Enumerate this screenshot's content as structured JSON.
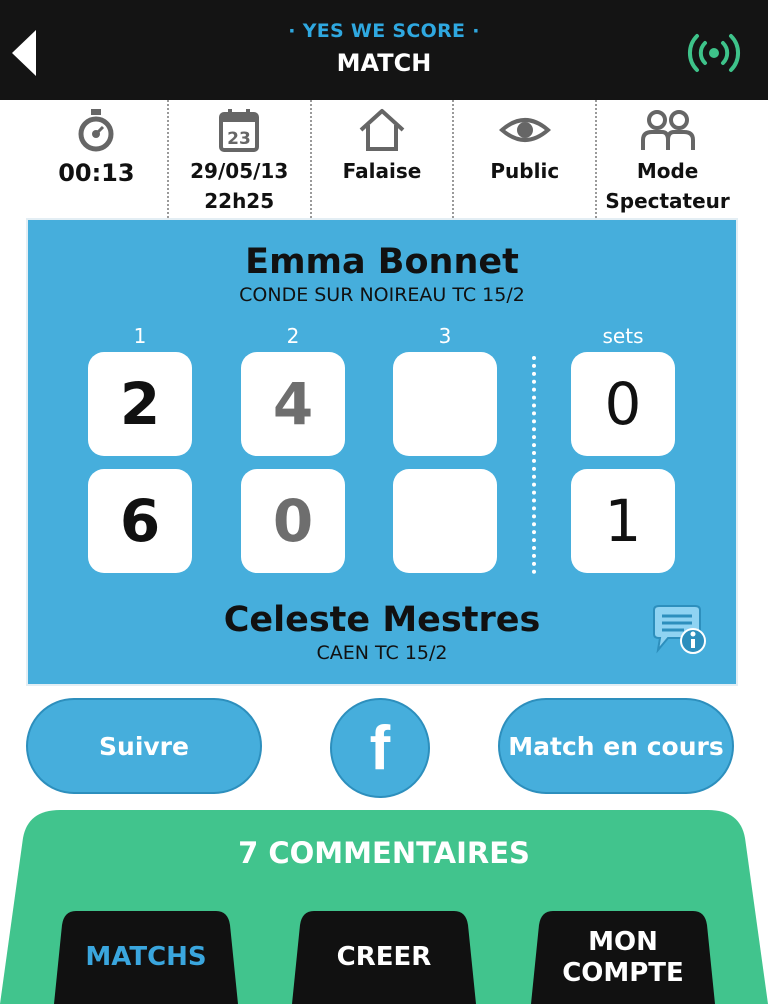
{
  "header": {
    "brand": "· YES WE SCORE ·",
    "title": "MATCH"
  },
  "info": {
    "timer": "00:13",
    "date": "29/05/13",
    "time": "22h25",
    "calendar_day": "23",
    "location": "Falaise",
    "visibility": "Public",
    "mode_line1": "Mode",
    "mode_line2": "Spectateur"
  },
  "match": {
    "player1": {
      "name": "Emma Bonnet",
      "club": "CONDE SUR NOIREAU TC 15/2"
    },
    "player2": {
      "name": "Celeste Mestres",
      "club": "CAEN TC 15/2"
    },
    "column_labels": [
      "1",
      "2",
      "3",
      "sets"
    ],
    "player1_scores": [
      "2",
      "4",
      "",
      "0"
    ],
    "player2_scores": [
      "6",
      "0",
      "",
      "1"
    ]
  },
  "actions": {
    "follow": "Suivre",
    "facebook": "f",
    "current_match": "Match en cours"
  },
  "comments": "7 COMMENTAIRES",
  "tabs": {
    "matches": "MATCHS",
    "create": "CREER",
    "account_line1": "MON",
    "account_line2": "COMPTE"
  },
  "colors": {
    "header_bg": "#141414",
    "brand": "#2fa8e0",
    "panel": "#46aedc",
    "live": "#3ec38a",
    "bottom": "#41c48d",
    "tab_active": "#3aa6de"
  },
  "icons": [
    "back-arrow-icon",
    "live-signal-icon",
    "stopwatch-icon",
    "calendar-icon",
    "home-icon",
    "eye-icon",
    "spectators-icon",
    "info-bubble-icon",
    "facebook-icon"
  ]
}
